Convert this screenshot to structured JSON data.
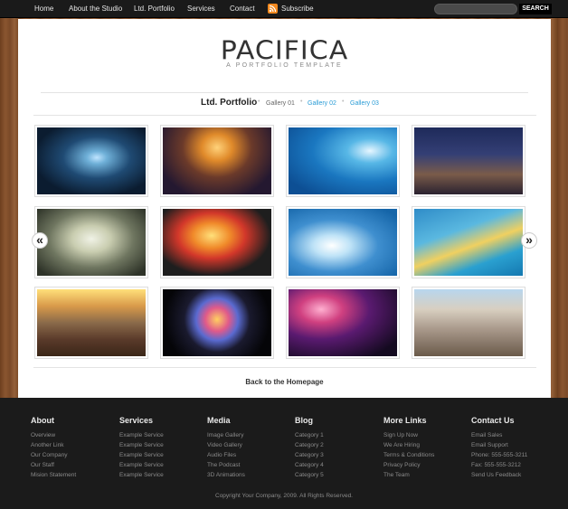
{
  "nav": {
    "items": [
      "Home",
      "About the Studio",
      "Ltd. Portfolio",
      "Services",
      "Contact"
    ],
    "subscribe": "Subscribe",
    "search_placeholder": "",
    "search_button": "SEARCH"
  },
  "header": {
    "logo": "PACIFICA",
    "tagline": "A PORTFOLIO TEMPLATE"
  },
  "portfolio": {
    "title": "Ltd. Portfolio",
    "galleries": [
      "Gallery 01",
      "Gallery 02",
      "Gallery 03"
    ],
    "prev_arrow": "«",
    "next_arrow": "»",
    "back_link": "Back to the Homepage"
  },
  "footer": {
    "columns": [
      {
        "heading": "About",
        "items": [
          "Overview",
          "Another Link",
          "Our Company",
          "Our Staff",
          "Mision Statement"
        ]
      },
      {
        "heading": "Services",
        "items": [
          "Example Service",
          "Example Service",
          "Example Service",
          "Example Service",
          "Example Service"
        ]
      },
      {
        "heading": "Media",
        "items": [
          "Image Gallery",
          "Video Gallery",
          "Audio Files",
          "The Podcast",
          "3D Animations"
        ]
      },
      {
        "heading": "Blog",
        "items": [
          "Category 1",
          "Category 2",
          "Category 3",
          "Category 4",
          "Category 5"
        ]
      },
      {
        "heading": "More Links",
        "items": [
          "Sign Up Now",
          "We Are Hiring",
          "Terms & Conditions",
          "Privacy Policy",
          "The Team"
        ]
      },
      {
        "heading": "Contact Us",
        "items": [
          "Email Sales",
          "Email Support",
          "Phone: 555-555-3211",
          "Fax: 555-555-3212",
          "Send Us Feedback"
        ]
      }
    ],
    "copyright": "Copyright Your Company, 2009. All Rights Reserved."
  },
  "colors": {
    "link_blue": "#2a9cd6",
    "rss_orange": "#f2891f",
    "footer_bg": "#1b1b1b"
  }
}
